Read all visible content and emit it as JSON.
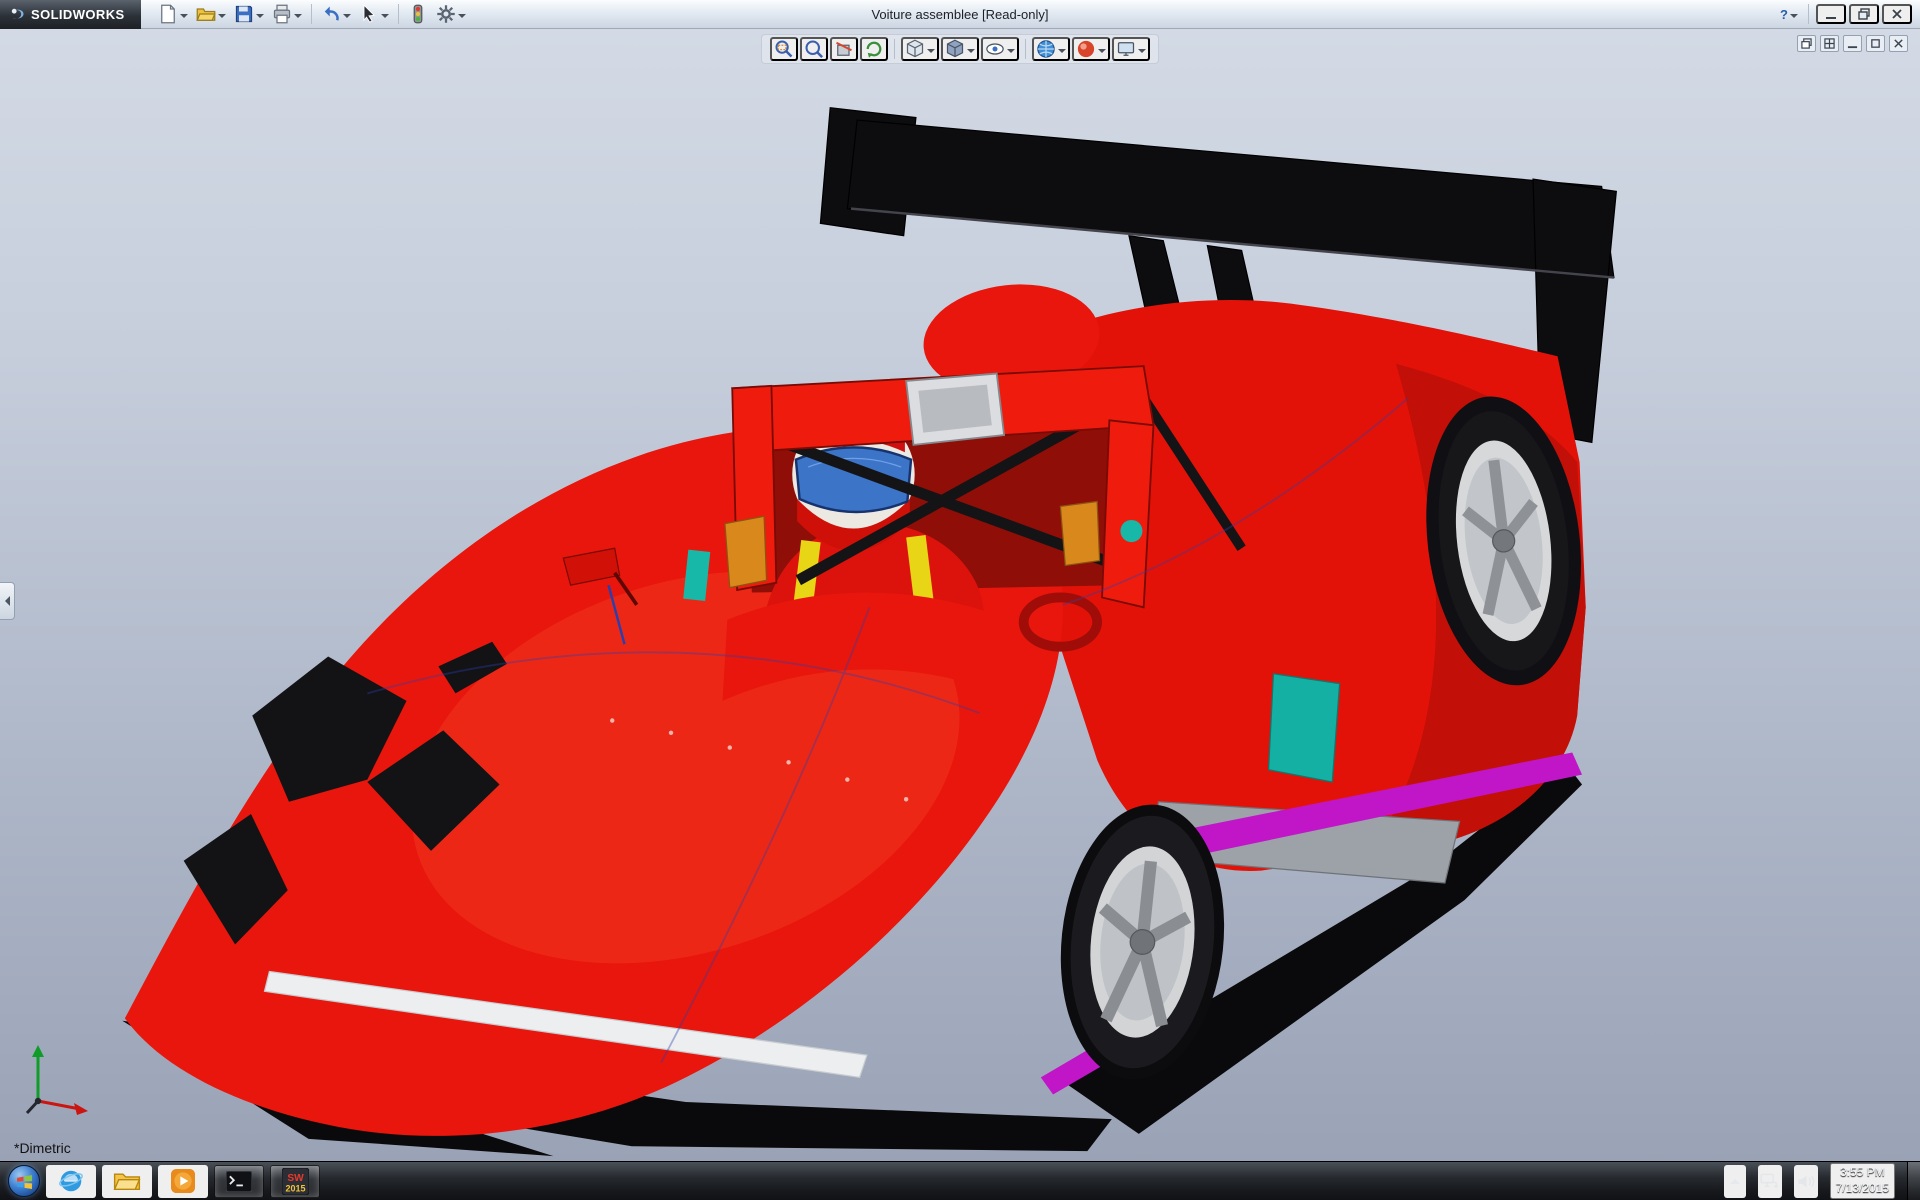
{
  "titlebar": {
    "brand": "SOLIDWORKS",
    "title": "Voiture assemblee [Read-only]",
    "help_label": "?",
    "tools": [
      "new",
      "open",
      "save",
      "print",
      "undo",
      "select",
      "rebuild",
      "options"
    ]
  },
  "hud": {
    "items": [
      "zoom-area",
      "zoom-to-fit",
      "section-view",
      "rotate-view",
      "view-orientation",
      "display-style",
      "hide-show-items",
      "apply-scene",
      "edit-appearance",
      "view-settings"
    ]
  },
  "doc_controls": [
    "cascade",
    "tile",
    "minimize",
    "restore",
    "close"
  ],
  "viewport": {
    "view_label": "*Dimetric",
    "model": "red prototype race car assembly with rear wing and driver",
    "colors": {
      "body_red": "#e8160c",
      "wing_black": "#0d0d10",
      "background_top": "#d3dae5",
      "background_bottom": "#9aa3b6",
      "accent_teal": "#14b0a4",
      "accent_magenta": "#c016c8"
    }
  },
  "taskbar": {
    "items": [
      "start",
      "internet-explorer",
      "file-explorer",
      "media-player",
      "command-prompt",
      "solidworks-2015"
    ],
    "sw_label": "SW",
    "sw_year": "2015",
    "tray_items": [
      "hidden-icons",
      "network",
      "volume"
    ],
    "time": "3:55 PM",
    "date": "7/13/2015"
  }
}
